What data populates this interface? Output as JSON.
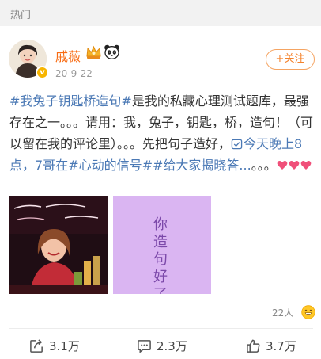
{
  "section": {
    "title": "热门"
  },
  "post": {
    "author": "戚薇",
    "verified_mark": "v",
    "date": "20-9-22",
    "follow_label": "+关注",
    "text": {
      "tag1": "#我兔子钥匙桥造句#",
      "p1": "是我的私藏心理测试题库，最强存在之一。。。请用：我，兔子，钥匙，桥，造句！（可以留在我的评论里）。。。先把句子造好，",
      "highlight": "今天晚上8点，7哥在",
      "tag2": "#心动的信号#",
      "tag3": "#给大家揭晓答...",
      "p2": "。。。"
    },
    "image_right_text": "你造句好了",
    "liker_count": "22人",
    "actions": {
      "repost": "3.1万",
      "comment": "2.3万",
      "like": "3.7万"
    }
  },
  "colors": {
    "username": "#f86b12",
    "link": "#4b79b5",
    "follow": "#f4822b",
    "heart": "#f0507a",
    "purple_panel": "#dab5f2"
  },
  "icons": [
    "crown-icon",
    "panda-icon",
    "heart-icon",
    "repost-icon",
    "comment-icon",
    "like-icon",
    "grin-emoji-icon"
  ]
}
